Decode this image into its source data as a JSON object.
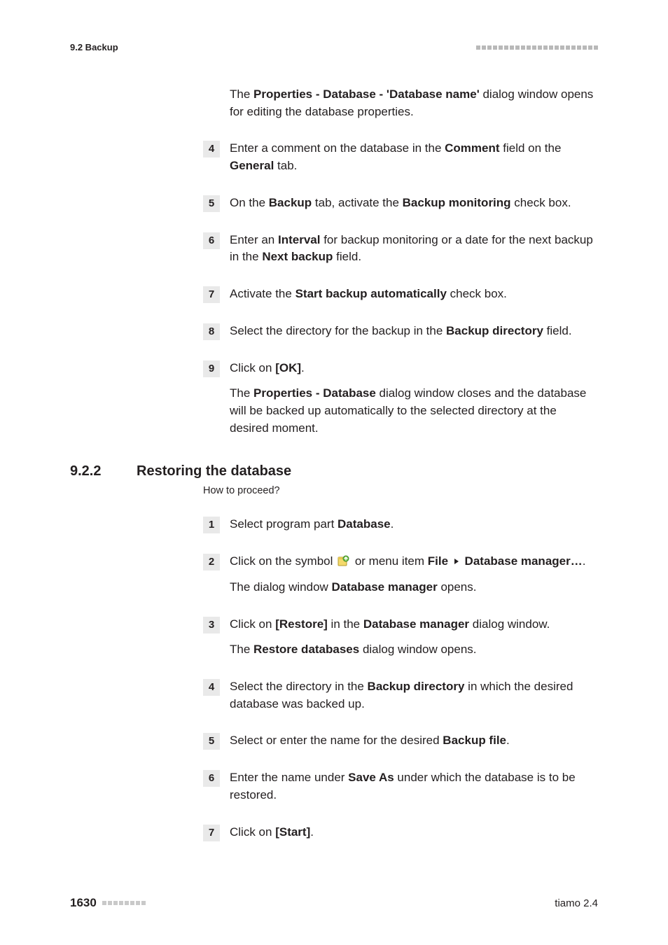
{
  "header": {
    "section_ref": "9.2 Backup"
  },
  "intro_paragraph": {
    "pre": "The ",
    "bold": "Properties - Database - 'Database name'",
    "post": " dialog window opens for editing the database properties."
  },
  "stepsA": [
    {
      "num": "4",
      "segments": [
        {
          "t": "Enter a comment on the database in the "
        },
        {
          "t": "Comment",
          "b": true
        },
        {
          "t": " field on the "
        },
        {
          "t": "General",
          "b": true
        },
        {
          "t": " tab."
        }
      ]
    },
    {
      "num": "5",
      "segments": [
        {
          "t": "On the "
        },
        {
          "t": "Backup",
          "b": true
        },
        {
          "t": " tab, activate the "
        },
        {
          "t": "Backup monitoring",
          "b": true
        },
        {
          "t": " check box."
        }
      ]
    },
    {
      "num": "6",
      "segments": [
        {
          "t": "Enter an "
        },
        {
          "t": "Interval",
          "b": true
        },
        {
          "t": " for backup monitoring or a date for the next backup in the "
        },
        {
          "t": "Next backup",
          "b": true
        },
        {
          "t": " field."
        }
      ]
    },
    {
      "num": "7",
      "segments": [
        {
          "t": "Activate the "
        },
        {
          "t": "Start backup automatically",
          "b": true
        },
        {
          "t": " check box."
        }
      ]
    },
    {
      "num": "8",
      "segments": [
        {
          "t": "Select the directory for the backup in the "
        },
        {
          "t": "Backup directory",
          "b": true
        },
        {
          "t": " field."
        }
      ]
    }
  ],
  "step9": {
    "num": "9",
    "line1": [
      {
        "t": "Click on "
      },
      {
        "t": "[OK]",
        "b": true
      },
      {
        "t": "."
      }
    ],
    "line2_pre": "The ",
    "line2_bold": "Properties - Database",
    "line2_post": " dialog window closes and the database will be backed up automatically to the selected directory at the desired moment."
  },
  "section": {
    "num": "9.2.2",
    "title": "Restoring the database",
    "howto": "How to proceed?"
  },
  "stepsB": {
    "s1": {
      "num": "1",
      "segments": [
        {
          "t": "Select program part "
        },
        {
          "t": "Database",
          "b": true
        },
        {
          "t": "."
        }
      ]
    },
    "s2": {
      "num": "2",
      "pre": "Click on the symbol ",
      "mid": " or menu item ",
      "file": "File",
      "dbm": "Database manager…",
      "tail": ".",
      "result_pre": "The dialog window ",
      "result_bold": "Database manager",
      "result_post": " opens."
    },
    "s3": {
      "num": "3",
      "line1": [
        {
          "t": "Click on "
        },
        {
          "t": "[Restore]",
          "b": true
        },
        {
          "t": " in the "
        },
        {
          "t": "Database manager",
          "b": true
        },
        {
          "t": " dialog window."
        }
      ],
      "line2_pre": "The ",
      "line2_bold": "Restore databases",
      "line2_post": " dialog window opens."
    },
    "s4": {
      "num": "4",
      "segments": [
        {
          "t": "Select the directory in the "
        },
        {
          "t": "Backup directory",
          "b": true
        },
        {
          "t": " in which the desired database was backed up."
        }
      ]
    },
    "s5": {
      "num": "5",
      "segments": [
        {
          "t": "Select or enter the name for the desired "
        },
        {
          "t": "Backup file",
          "b": true
        },
        {
          "t": "."
        }
      ]
    },
    "s6": {
      "num": "6",
      "segments": [
        {
          "t": "Enter the name under "
        },
        {
          "t": "Save As",
          "b": true
        },
        {
          "t": " under which the database is to be restored."
        }
      ]
    },
    "s7": {
      "num": "7",
      "segments": [
        {
          "t": "Click on "
        },
        {
          "t": "[Start]",
          "b": true
        },
        {
          "t": "."
        }
      ]
    }
  },
  "footer": {
    "page": "1630",
    "product": "tiamo 2.4"
  }
}
